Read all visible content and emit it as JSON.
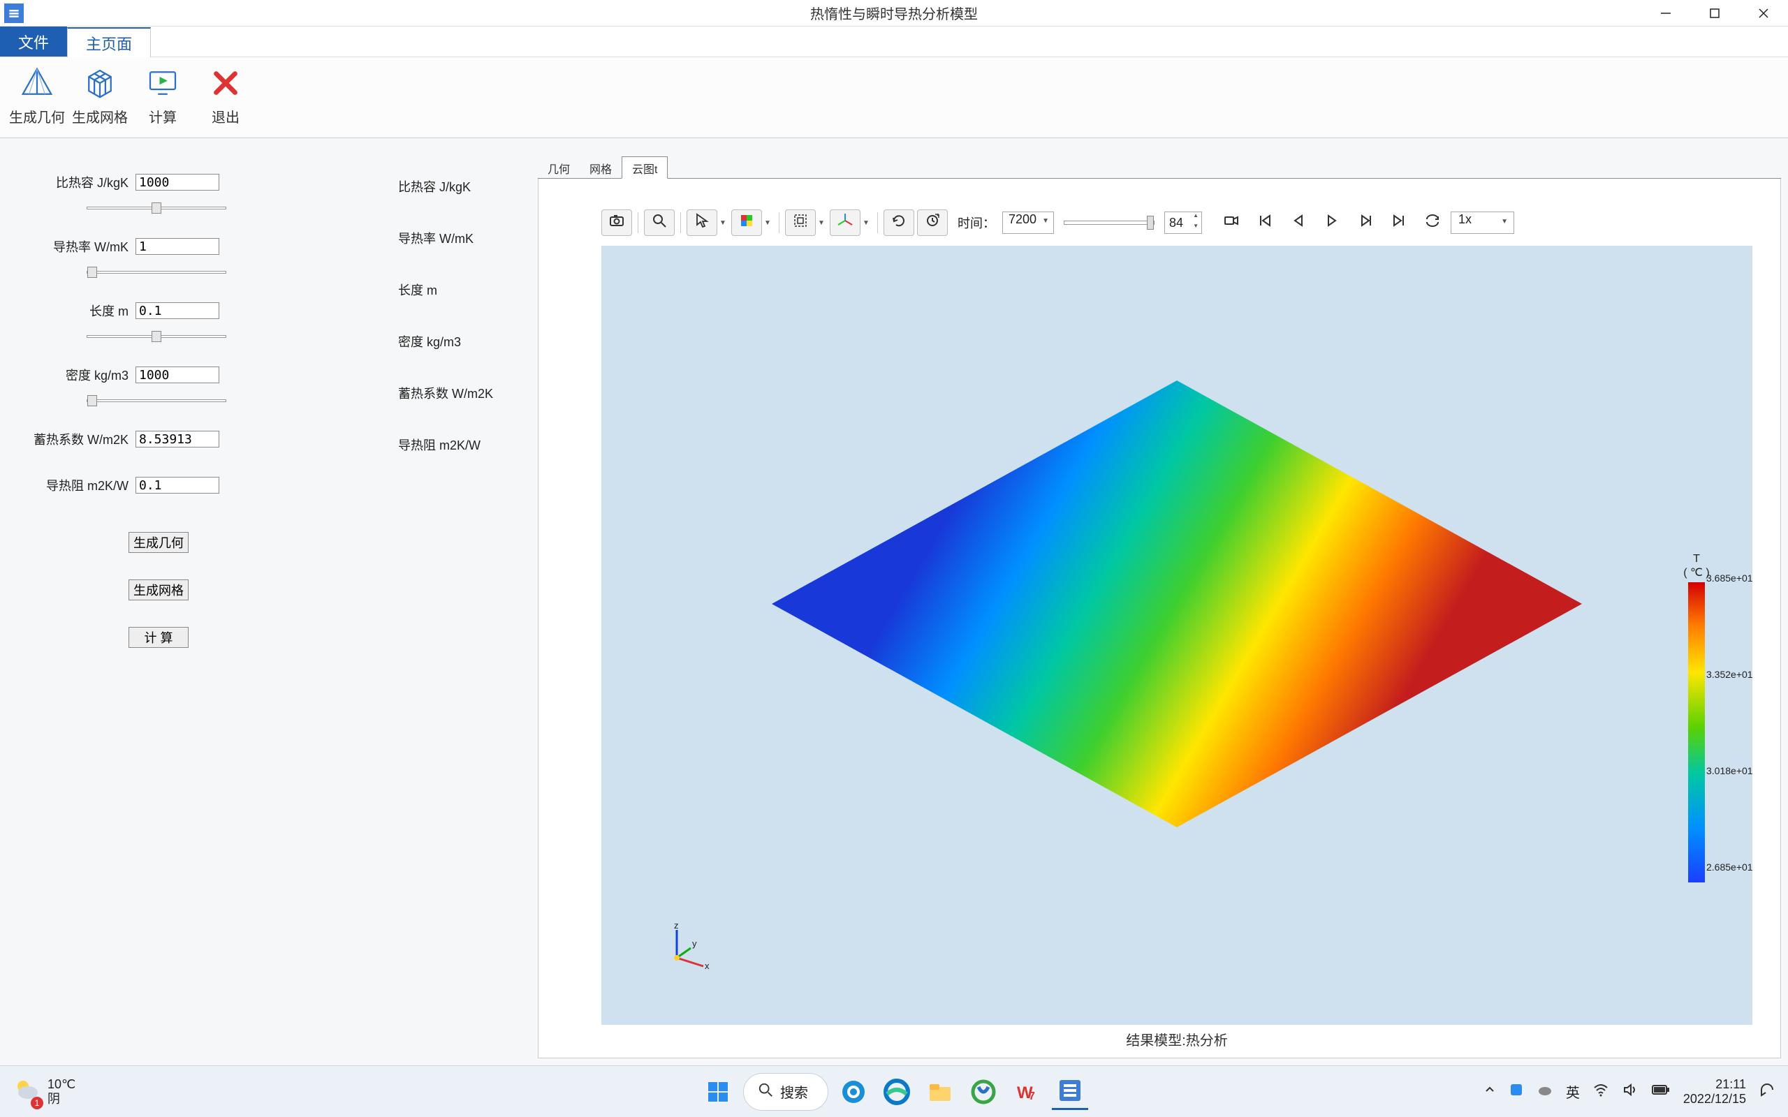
{
  "title": "热惰性与瞬时导热分析模型",
  "ribbon_tabs": {
    "file": "文件",
    "main": "主页面"
  },
  "ribbon": {
    "gen_geo": "生成几何",
    "gen_mesh": "生成网格",
    "compute": "计算",
    "exit": "退出"
  },
  "inputs": {
    "specific_heat": {
      "label": "比热容 J/kgK",
      "value": "1000"
    },
    "conductivity": {
      "label": "导热率 W/mK",
      "value": "1"
    },
    "length": {
      "label": "长度 m",
      "value": "0.1"
    },
    "density": {
      "label": "密度 kg/m3",
      "value": "1000"
    },
    "storage": {
      "label": "蓄热系数 W/m2K",
      "value": "8.53913"
    },
    "resistance": {
      "label": "导热阻 m2K/W",
      "value": "0.1"
    }
  },
  "outputs": {
    "specific_heat": "比热容 J/kgK",
    "conductivity": "导热率 W/mK",
    "length": "长度 m",
    "density": "密度 kg/m3",
    "storage": "蓄热系数 W/m2K",
    "resistance": "导热阻 m2K/W"
  },
  "actions": {
    "gen_geo": "生成几何",
    "gen_mesh": "生成网格",
    "compute": "计 算"
  },
  "viewport_tabs": {
    "geom": "几何",
    "mesh": "网格",
    "cloud": "云图t"
  },
  "viewer": {
    "time_label": "时间：",
    "time_value": "7200",
    "frame_value": "84",
    "speed_value": "1x"
  },
  "legend": {
    "title_line1": "T",
    "title_line2": "( ℃ )",
    "ticks": [
      "3.685e+01",
      "3.352e+01",
      "3.018e+01",
      "2.685e+01"
    ]
  },
  "result_footer": "结果模型:热分析",
  "taskbar": {
    "temp": "10℃",
    "weather_desc": "阴",
    "weather_badge": "1",
    "search_placeholder": "搜索",
    "ime": "英",
    "time": "21:11",
    "date": "2022/12/15"
  }
}
